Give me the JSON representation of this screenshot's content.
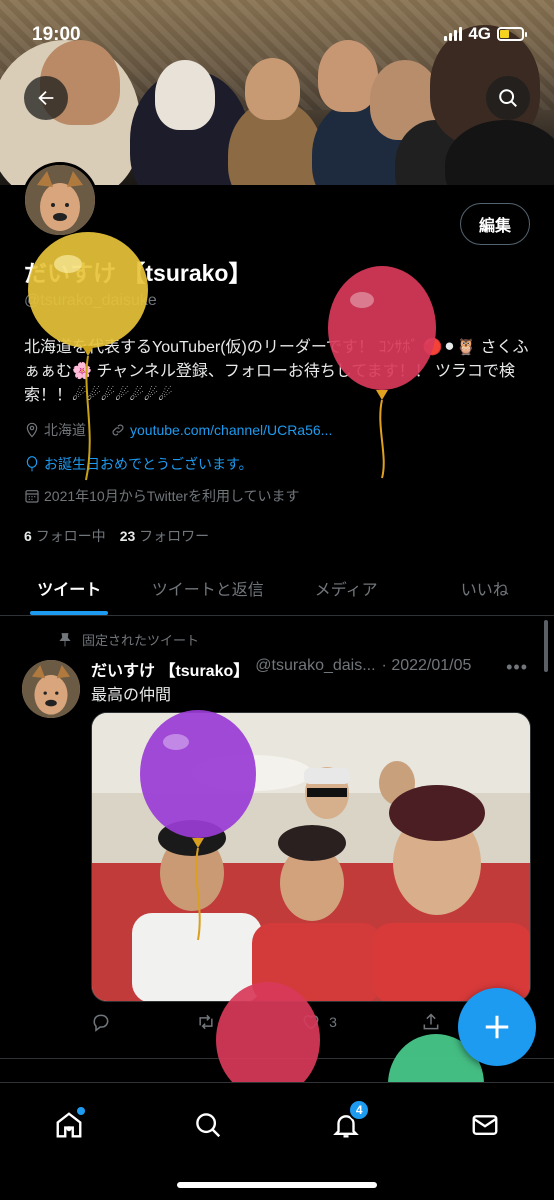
{
  "status_bar": {
    "time": "19:00",
    "network": "4G"
  },
  "profile": {
    "edit_label": "編集",
    "name": "だいすけ 【tsurako】",
    "handle": "@tsurako_daisuke",
    "bio": "北海道を代表するYouTuber(仮)のリーダーです！ ｺﾝｻﾎﾞ 🔴⚫🦉 さくふぁぁむ🌸 チャンネル登録、フォローお待ちしてます！！ ツラコで検索！！☄☄☄☄☄☄☄",
    "location": "北海道",
    "website": "youtube.com/channel/UCRa56...",
    "birthday": "お誕生日おめでとうございます。",
    "joined": "2021年10月からTwitterを利用しています",
    "following_count": "6",
    "following_label": "フォロー中",
    "followers_count": "23",
    "followers_label": "フォロワー"
  },
  "tabs": [
    {
      "label": "ツイート",
      "active": true
    },
    {
      "label": "ツイートと返信",
      "active": false
    },
    {
      "label": "メディア",
      "active": false
    },
    {
      "label": "いいね",
      "active": false
    }
  ],
  "tweet": {
    "pinned_label": "固定されたツイート",
    "name": "だいすけ 【tsurako】",
    "handle": "@tsurako_dais...",
    "date": "· 2022/01/05",
    "text": "最高の仲間",
    "like_count": "3"
  },
  "nav": {
    "notifications_badge": "4"
  },
  "colors": {
    "accent": "#1d9bf0",
    "background": "#000000",
    "muted": "#71767b"
  }
}
